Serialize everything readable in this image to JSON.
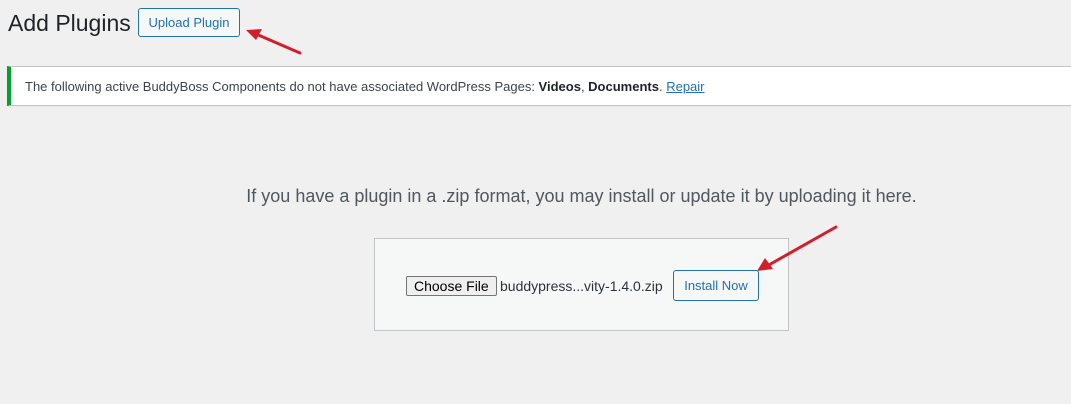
{
  "header": {
    "title": "Add Plugins",
    "upload_button_label": "Upload Plugin"
  },
  "notice": {
    "text_prefix": "The following active BuddyBoss Components do not have associated WordPress Pages: ",
    "item_1": "Videos",
    "separator": ", ",
    "item_2": "Documents",
    "period": ". ",
    "link_label": "Repair",
    "accent_color": "#00a32a"
  },
  "upload": {
    "help_text": "If you have a plugin in a .zip format, you may install or update it by uploading it here.",
    "choose_file_label": "Choose File",
    "file_name": "buddypress...vity-1.4.0.zip",
    "install_button_label": "Install Now"
  },
  "annotations": {
    "arrow_color": "#d1202a"
  }
}
